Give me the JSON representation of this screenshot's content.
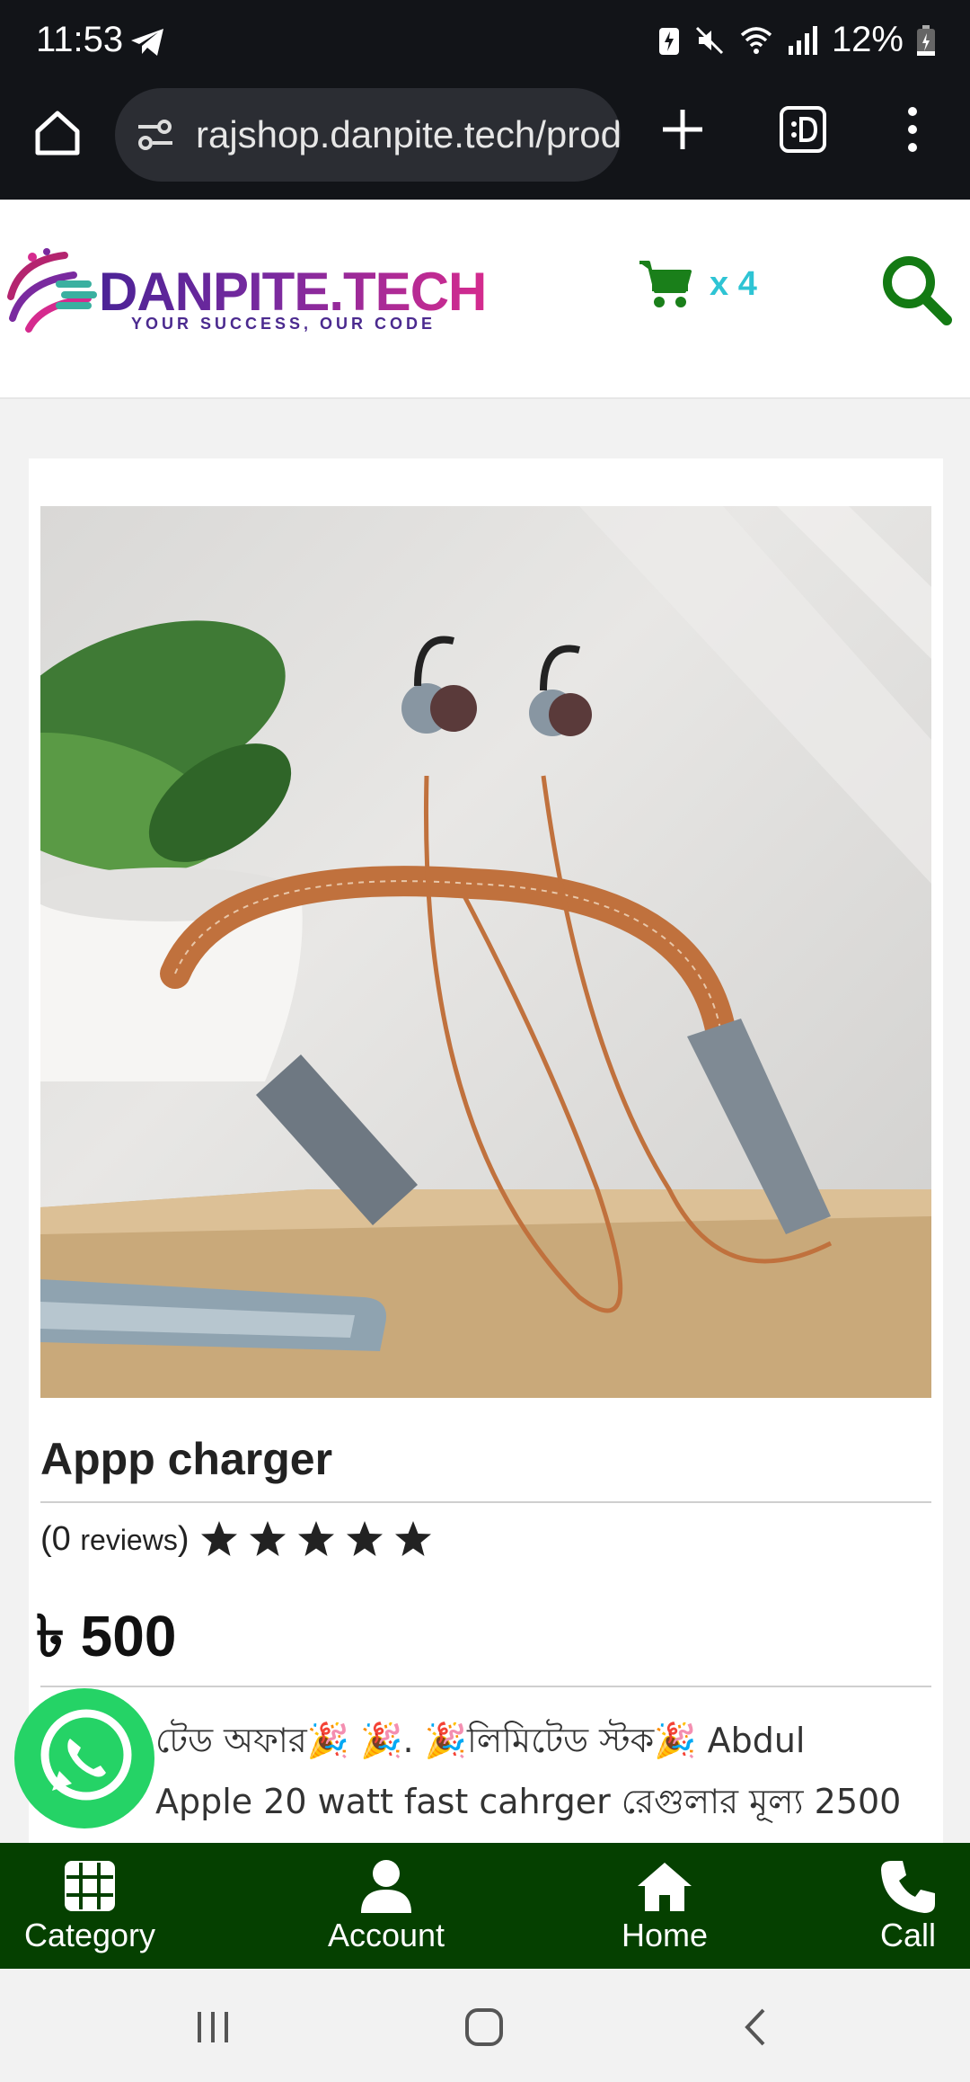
{
  "status_bar": {
    "time": "11:53",
    "battery": "12%"
  },
  "browser": {
    "url": "rajshop.danpite.tech/product"
  },
  "header": {
    "logo_text": "DANPITE.TECH",
    "logo_tagline": "YOUR SUCCESS, OUR CODE",
    "cart_count": "x 4",
    "colors": {
      "cart": "#1a7f1a",
      "cart_count": "#2ec4d4",
      "search": "#137a13"
    }
  },
  "product": {
    "title": "Appp charger",
    "reviews_open": "(0 ",
    "reviews_word": "reviews",
    "reviews_close": ")",
    "rating_stars": 5,
    "price": "৳ 500",
    "description_line1": "টেড অফার🎉 🎉. 🎉লিমিটেড স্টক🎉 Abdul",
    "description_line2": "Apple 20 watt fast cahrger রেগুলার মূল্য 2500"
  },
  "bottom_nav": {
    "category": "Category",
    "account": "Account",
    "home": "Home",
    "call": "Call",
    "background": "#054000"
  }
}
